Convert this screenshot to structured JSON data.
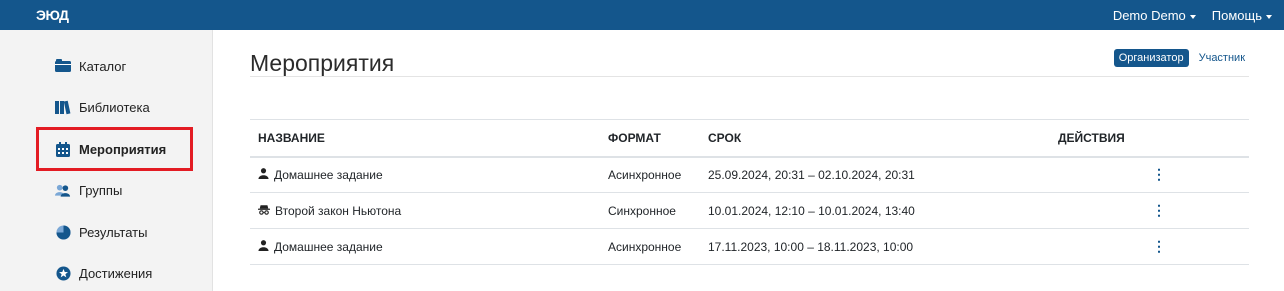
{
  "header": {
    "logo": "ЭЮД",
    "user_menu": "Demo Demo",
    "help_menu": "Помощь"
  },
  "sidebar": {
    "items": [
      {
        "label": "Каталог",
        "icon": "folder-icon"
      },
      {
        "label": "Библиотека",
        "icon": "books-icon"
      },
      {
        "label": "Мероприятия",
        "icon": "calendar-icon"
      },
      {
        "label": "Группы",
        "icon": "users-icon"
      },
      {
        "label": "Результаты",
        "icon": "pie-chart-icon"
      },
      {
        "label": "Достижения",
        "icon": "star-icon"
      }
    ],
    "active": "Мероприятия"
  },
  "main": {
    "title": "Мероприятия",
    "roles": {
      "organizer": "Организатор",
      "participant": "Участник"
    },
    "table": {
      "headers": {
        "name": "НАЗВАНИЕ",
        "format": "ФОРМАТ",
        "period": "СРОК",
        "actions": "ДЕЙСТВИЯ"
      },
      "rows": [
        {
          "name": "Домашнее задание",
          "icon": "user-icon",
          "format": "Асинхронное",
          "period": "25.09.2024, 20:31 – 02.10.2024, 20:31",
          "action": "⋮"
        },
        {
          "name": "Второй закон Ньютона",
          "icon": "incognito-icon",
          "format": "Синхронное",
          "period": "10.01.2024, 12:10 – 10.01.2024, 13:40",
          "action": "⋮"
        },
        {
          "name": "Домашнее задание",
          "icon": "user-icon",
          "format": "Асинхронное",
          "period": "17.11.2023, 10:00 – 18.11.2023, 10:00",
          "action": "⋮"
        }
      ]
    }
  },
  "colors": {
    "brand": "#14568c",
    "highlight": "#e31b23"
  }
}
